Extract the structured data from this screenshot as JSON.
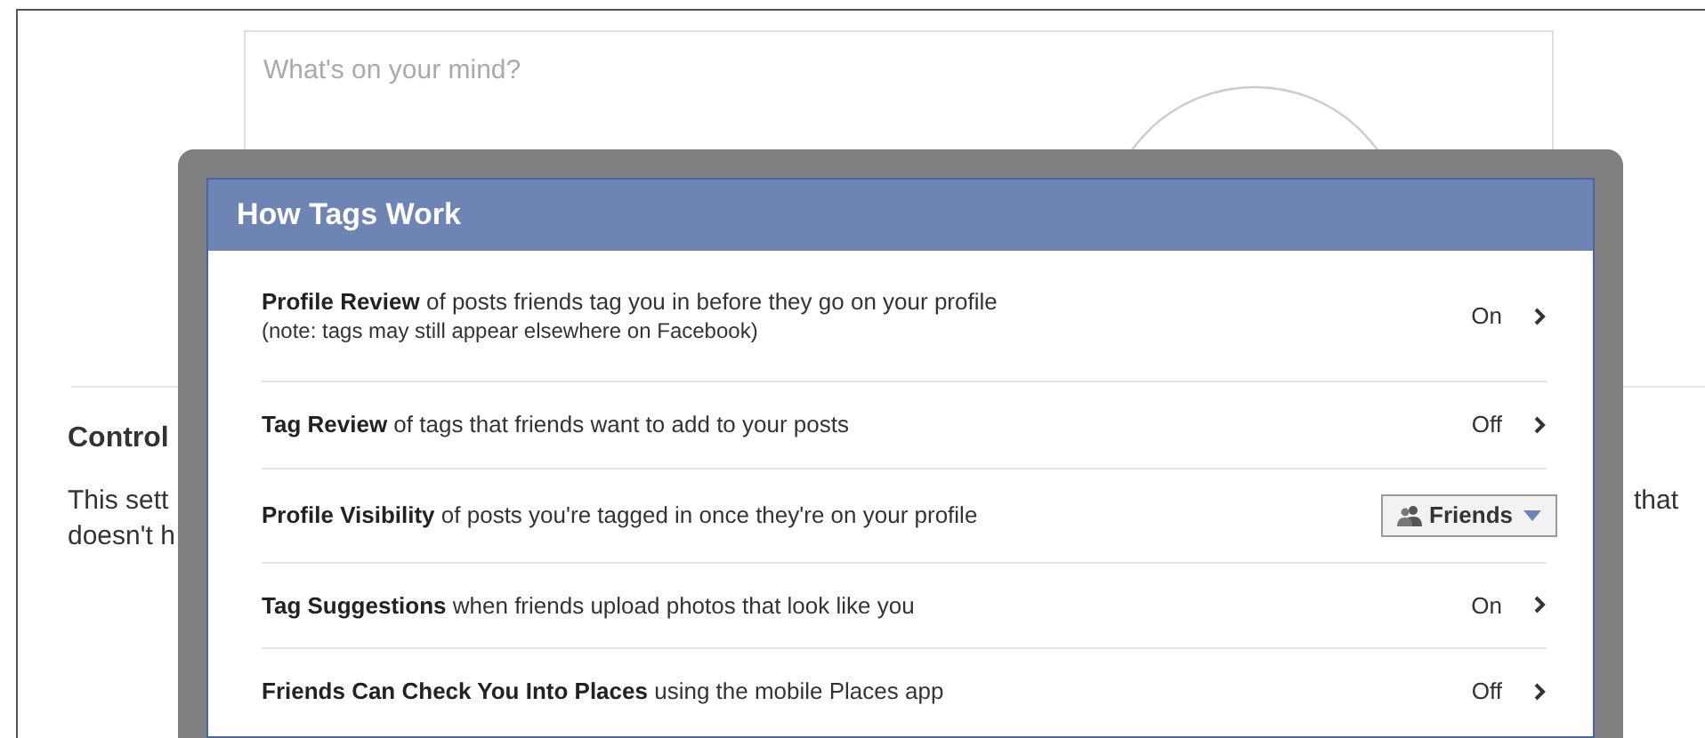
{
  "composer": {
    "placeholder": "What's on your mind?"
  },
  "background_section": {
    "heading": "Control",
    "lines": [
      "This sett",
      "doesn't h"
    ],
    "right_fragment": "that"
  },
  "dialog": {
    "title": "How Tags Work",
    "rows": [
      {
        "kind": "toggle",
        "label": "Profile Review",
        "text": "of posts friends tag you in before they go on your profile",
        "note": "(note: tags may still appear elsewhere on Facebook)",
        "value": "On"
      },
      {
        "kind": "toggle",
        "label": "Tag Review",
        "text": "of tags that friends want to add to your posts",
        "value": "Off"
      },
      {
        "kind": "dropdown",
        "label": "Profile Visibility",
        "text": "of posts you're tagged in once they're on your profile",
        "value": "Friends"
      },
      {
        "kind": "toggle",
        "label": "Tag Suggestions",
        "text": "when friends upload photos that look like you",
        "value": "On"
      },
      {
        "kind": "toggle",
        "label": "Friends Can Check You Into Places",
        "text": "using the mobile Places app",
        "value": "Off"
      }
    ]
  }
}
